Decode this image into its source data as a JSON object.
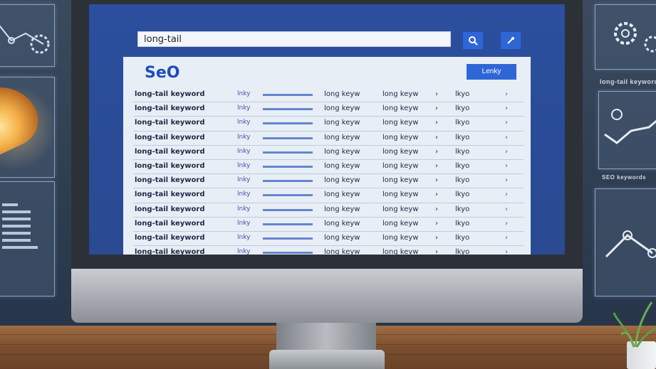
{
  "search": {
    "query": "long-tail"
  },
  "screen": {
    "logo": "SeO",
    "action_button": "Lenky",
    "rows": [
      [
        "long-tail keyword",
        "lnky",
        "long keyw",
        "long keyw",
        "›",
        "lkyo",
        "›"
      ],
      [
        "long-tail keyword",
        "lnky",
        "long keyw",
        "long keyw",
        "›",
        "lkyo",
        "›"
      ],
      [
        "long-tail keyword",
        "lnky",
        "long keyw",
        "long keyw",
        "›",
        "lkyo",
        "›"
      ],
      [
        "long-tail keyword",
        "lnky",
        "long keyw",
        "long keyw",
        "›",
        "lkyo",
        "›"
      ],
      [
        "long-tail keyword",
        "lnky",
        "long keyw",
        "long keyw",
        "›",
        "lkyo",
        "›"
      ],
      [
        "long-tail keyword",
        "lnky",
        "long keyw",
        "long keyw",
        "›",
        "lkyo",
        "›"
      ],
      [
        "long-tail keyword",
        "lnky",
        "long keyw",
        "long keyw",
        "›",
        "lkyo",
        "›"
      ],
      [
        "long-tail keyword",
        "lnky",
        "long keyw",
        "long keyw",
        "›",
        "lkyo",
        "›"
      ],
      [
        "long-tail keyword",
        "lnky",
        "long keyw",
        "long keyw",
        "›",
        "lkyo",
        "›"
      ],
      [
        "long-tail keyword",
        "lnky",
        "long keyw",
        "long keyw",
        "›",
        "lkyo",
        "›"
      ],
      [
        "long-tail keyword",
        "lnky",
        "long keyw",
        "long keyw",
        "›",
        "lkyo",
        "›"
      ],
      [
        "long-tail keyword",
        "lnky",
        "long keyw",
        "long keyw",
        "›",
        "lkyo",
        "›"
      ]
    ]
  },
  "wall": {
    "panel_right_caption": "long-tail keywords",
    "panel_right_caption2": "SEO keywords"
  },
  "colors": {
    "accent": "#2f66d6",
    "screen": "#2a4a92"
  },
  "icons": [
    "search-icon",
    "wrench-icon",
    "gear-icon",
    "line-chart-icon"
  ]
}
